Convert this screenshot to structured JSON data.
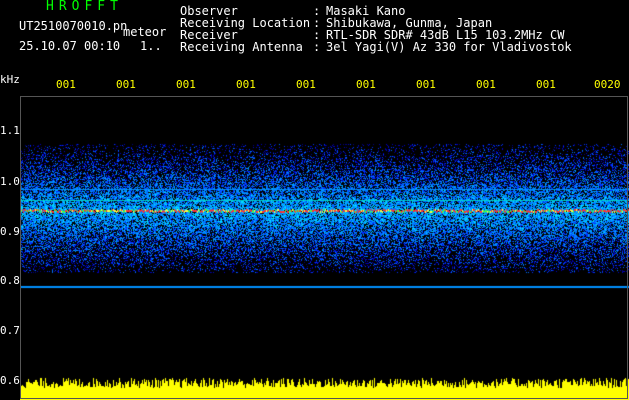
{
  "header": {
    "app_name": "HROFFT",
    "file_name": "UT2510070010.pn",
    "mode_label": "meteor",
    "date_time": "25.10.07 00:10",
    "sequence": "1.."
  },
  "info": [
    {
      "key": "Observer",
      "value": "Masaki Kano"
    },
    {
      "key": "Receiving Location",
      "value": "Shibukawa, Gunma, Japan"
    },
    {
      "key": "Receiver",
      "value": "RTL-SDR SDR# 43dB L15 103.2MHz CW"
    },
    {
      "key": "Receiving Antenna",
      "value": "3el Yagi(V) Az 330 for Vladivostok"
    }
  ],
  "axes": {
    "y_unit": "kHz",
    "y_ticks": [
      "1.1",
      "1.0",
      "0.9",
      "0.8",
      "0.7",
      "0.6"
    ],
    "x_ticks": [
      "001",
      "001",
      "001",
      "001",
      "001",
      "001",
      "001",
      "001",
      "001",
      "0020"
    ]
  },
  "colors": {
    "background": "#000000",
    "header_text": "#ffffff",
    "app_name": "#00ff00",
    "tick_text": "#ffff00",
    "noise_bar": "#ffff00",
    "signal_line": "#ff3333"
  },
  "spectrogram": {
    "freq_range_khz": [
      0.6,
      1.1
    ],
    "carrier_khz": 0.9,
    "echo_band_khz": [
      0.79,
      1.02
    ]
  }
}
